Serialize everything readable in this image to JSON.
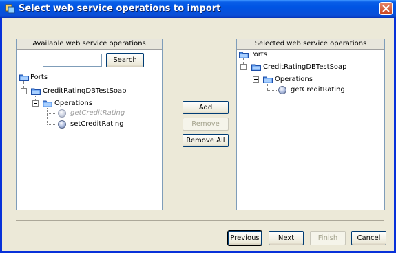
{
  "window": {
    "title": "Select web service operations to import",
    "icons": {
      "app": "app-icon",
      "close": "close-icon"
    }
  },
  "available": {
    "header": "Available web service operations",
    "search_value": "",
    "search_button": "Search",
    "tree": {
      "root": "Ports",
      "port": "CreditRatingDBTestSoap",
      "group": "Operations",
      "operations": [
        "getCreditRating",
        "setCreditRating"
      ]
    }
  },
  "middle_buttons": {
    "add": "Add",
    "remove": "Remove",
    "remove_all": "Remove All"
  },
  "selected": {
    "header": "Selected web service operations",
    "tree": {
      "root": "Ports",
      "port": "CreditRatingDBTestSoap",
      "group": "Operations",
      "operations": [
        "getCreditRating"
      ]
    }
  },
  "footer": {
    "previous": "Previous",
    "next": "Next",
    "finish": "Finish",
    "cancel": "Cancel"
  }
}
